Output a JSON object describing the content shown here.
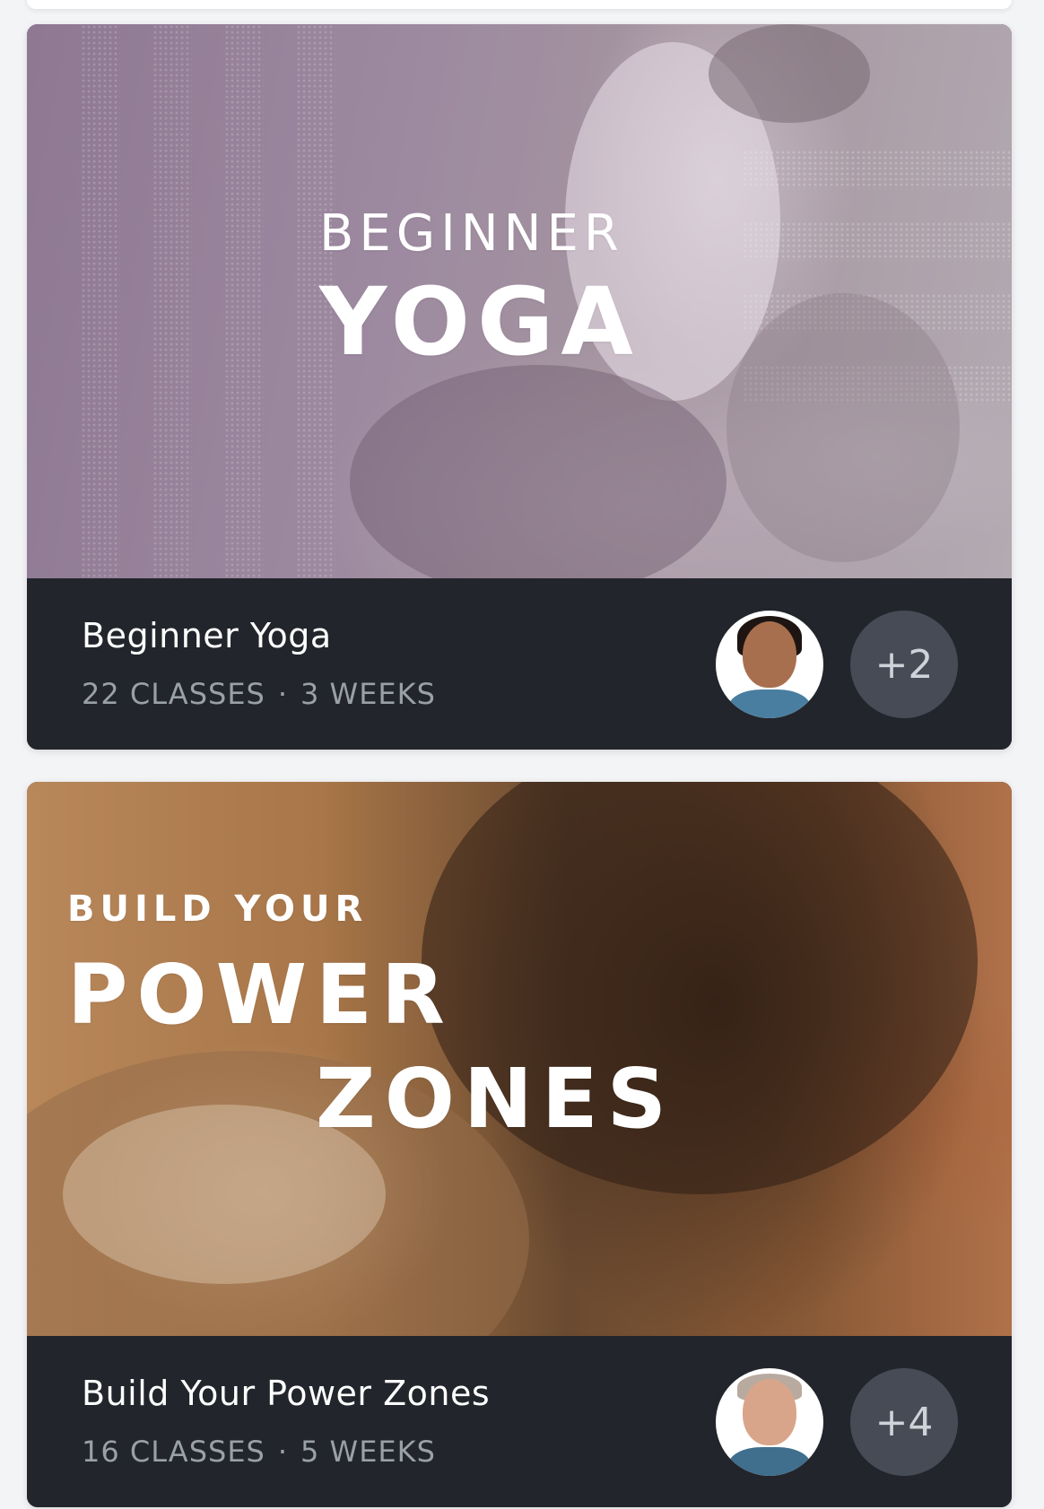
{
  "programs": [
    {
      "hero_line1": "BEGINNER",
      "hero_line2": "YOGA",
      "title": "Beginner Yoga",
      "classes": "22 CLASSES",
      "separator": "·",
      "weeks": "3 WEEKS",
      "more_instructors": "+2"
    },
    {
      "hero_line1": "BUILD YOUR",
      "hero_line2": "POWER",
      "hero_line3": "ZONES",
      "title": "Build Your Power Zones",
      "classes": "16 CLASSES",
      "separator": "·",
      "weeks": "5 WEEKS",
      "more_instructors": "+4"
    }
  ],
  "colors": {
    "background": "#f3f4f6",
    "card_footer": "#22252b",
    "meta_text": "#9aa0a8",
    "badge": "#474b55"
  }
}
